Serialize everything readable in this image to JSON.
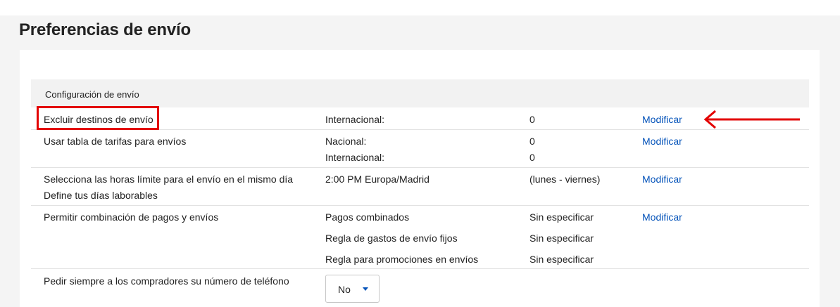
{
  "page": {
    "title": "Preferencias de envío"
  },
  "section": {
    "title": "Configuración de envío"
  },
  "rows": {
    "exclude": {
      "label": "Excluir destinos de envío",
      "key": "Internacional:",
      "value": "0",
      "action": "Modificar"
    },
    "rate_table": {
      "label": "Usar tabla de tarifas para envíos",
      "key1": "Nacional:",
      "value1": "0",
      "key2": "Internacional:",
      "value2": "0",
      "action": "Modificar"
    },
    "cutoff": {
      "label1": "Selecciona las horas límite para el envío en el mismo día",
      "label2": "Define tus días laborables",
      "key": "2:00 PM Europa/Madrid",
      "value": "(lunes - viernes)",
      "action": "Modificar"
    },
    "combined": {
      "label": "Permitir combinación de pagos y envíos",
      "key1": "Pagos combinados",
      "value1": "Sin especificar",
      "key2": "Regla de gastos de envío fijos",
      "value2": "Sin especificar",
      "key3": "Regla para promociones en envíos",
      "value3": "Sin especificar",
      "action": "Modificar"
    },
    "phone": {
      "label": "Pedir siempre a los compradores su número de teléfono",
      "select_value": "No"
    }
  },
  "annotations": {
    "highlight_color": "#e30000",
    "arrow_icon": "left-arrow-icon"
  },
  "colors": {
    "link": "#0654ba",
    "page_background": "#f4f4f4",
    "section_header_background": "#f2f2f2"
  }
}
